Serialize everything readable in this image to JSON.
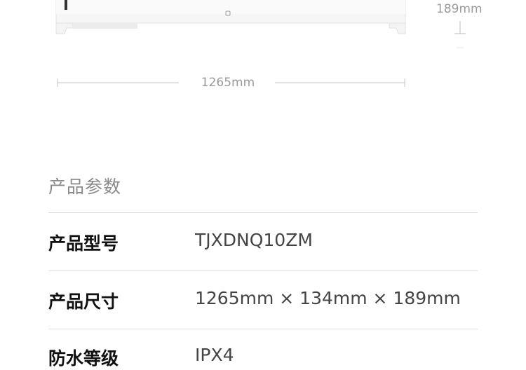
{
  "dimensions": {
    "height_label": "189mm",
    "width_label": "1265mm"
  },
  "specs": {
    "title": "产品参数",
    "rows": [
      {
        "label": "产品型号",
        "value": "TJXDNQ10ZM"
      },
      {
        "label": "产品尺寸",
        "value": "1265mm × 134mm × 189mm"
      },
      {
        "label": "防水等级",
        "value": "IPX4"
      }
    ]
  },
  "colors": {
    "divider": "#dcdcdc",
    "label_gray": "#9a9a9a"
  }
}
